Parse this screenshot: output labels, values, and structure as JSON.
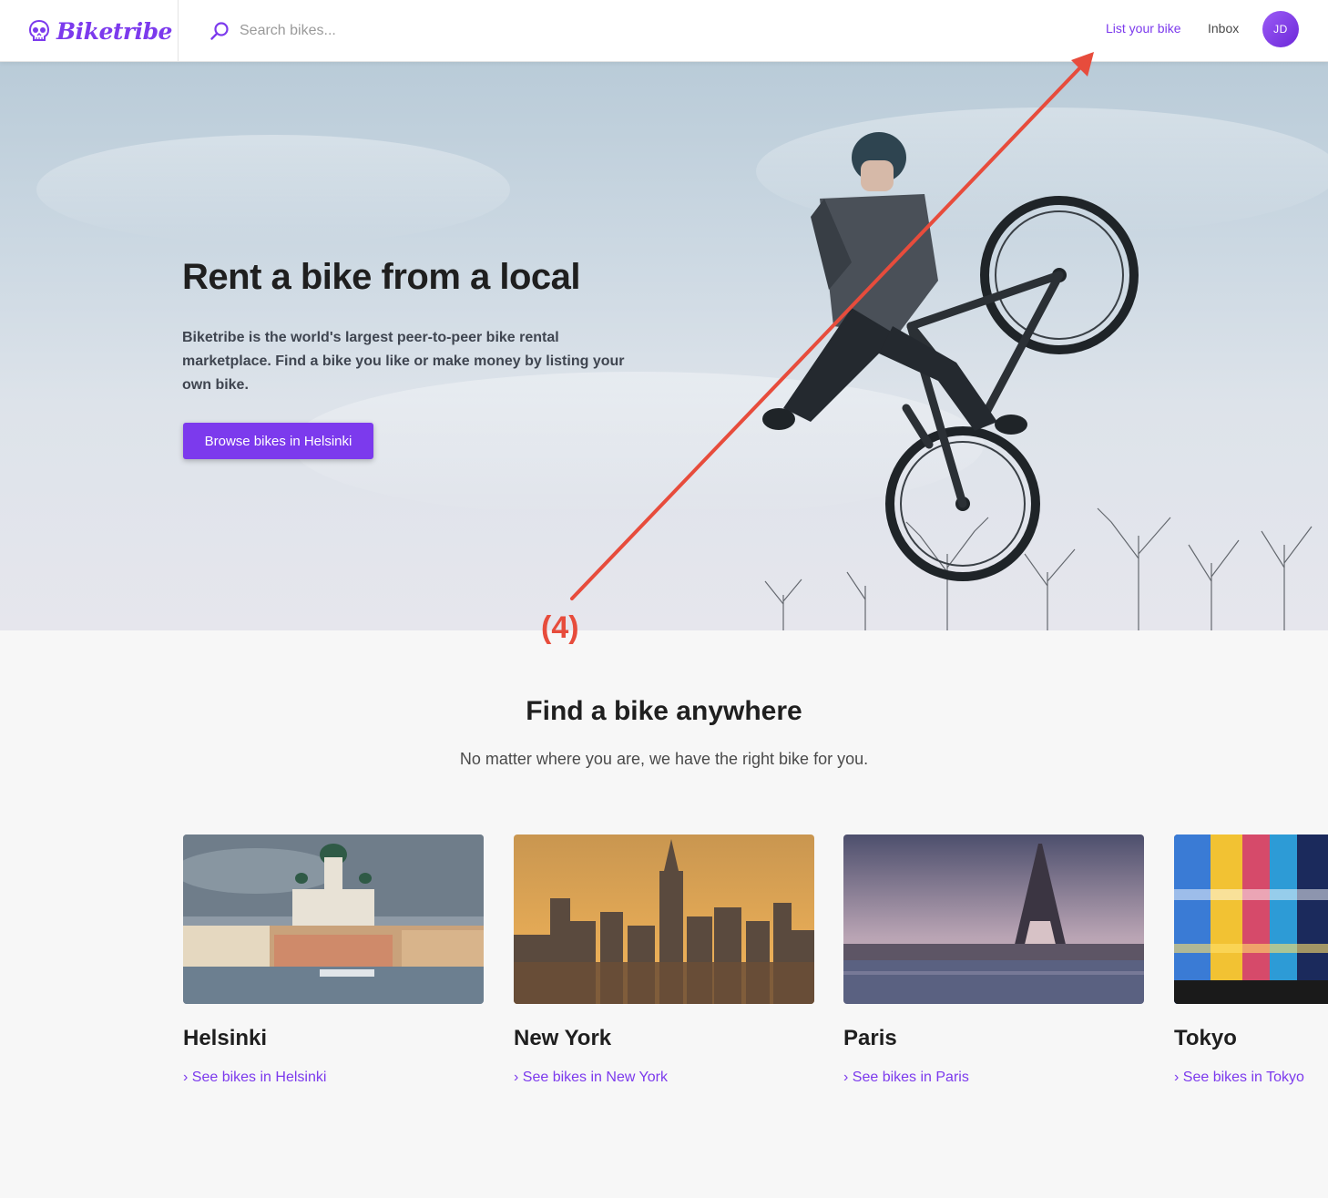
{
  "header": {
    "logo_text": "Biketribe",
    "search_placeholder": "Search bikes...",
    "nav": {
      "list_bike": "List your bike",
      "inbox": "Inbox"
    },
    "avatar_initials": "JD"
  },
  "hero": {
    "title": "Rent a bike from a local",
    "description": "Biketribe is the world's largest peer-to-peer bike rental marketplace. Find a bike you like or make money by listing your own bike.",
    "button_label": "Browse bikes in Helsinki"
  },
  "annotation": {
    "label": "(4)",
    "color": "#e74c3c"
  },
  "locations": {
    "title": "Find a bike anywhere",
    "subtitle": "No matter where you are, we have the right bike for you.",
    "cities": [
      {
        "name": "Helsinki",
        "link": "› See bikes in Helsinki"
      },
      {
        "name": "New York",
        "link": "› See bikes in New York"
      },
      {
        "name": "Paris",
        "link": "› See bikes in Paris"
      },
      {
        "name": "Tokyo",
        "link": "› See bikes in Tokyo"
      }
    ]
  },
  "colors": {
    "brand": "#7c3aed",
    "text": "#1f1f1f",
    "background": "#f7f7f7"
  }
}
